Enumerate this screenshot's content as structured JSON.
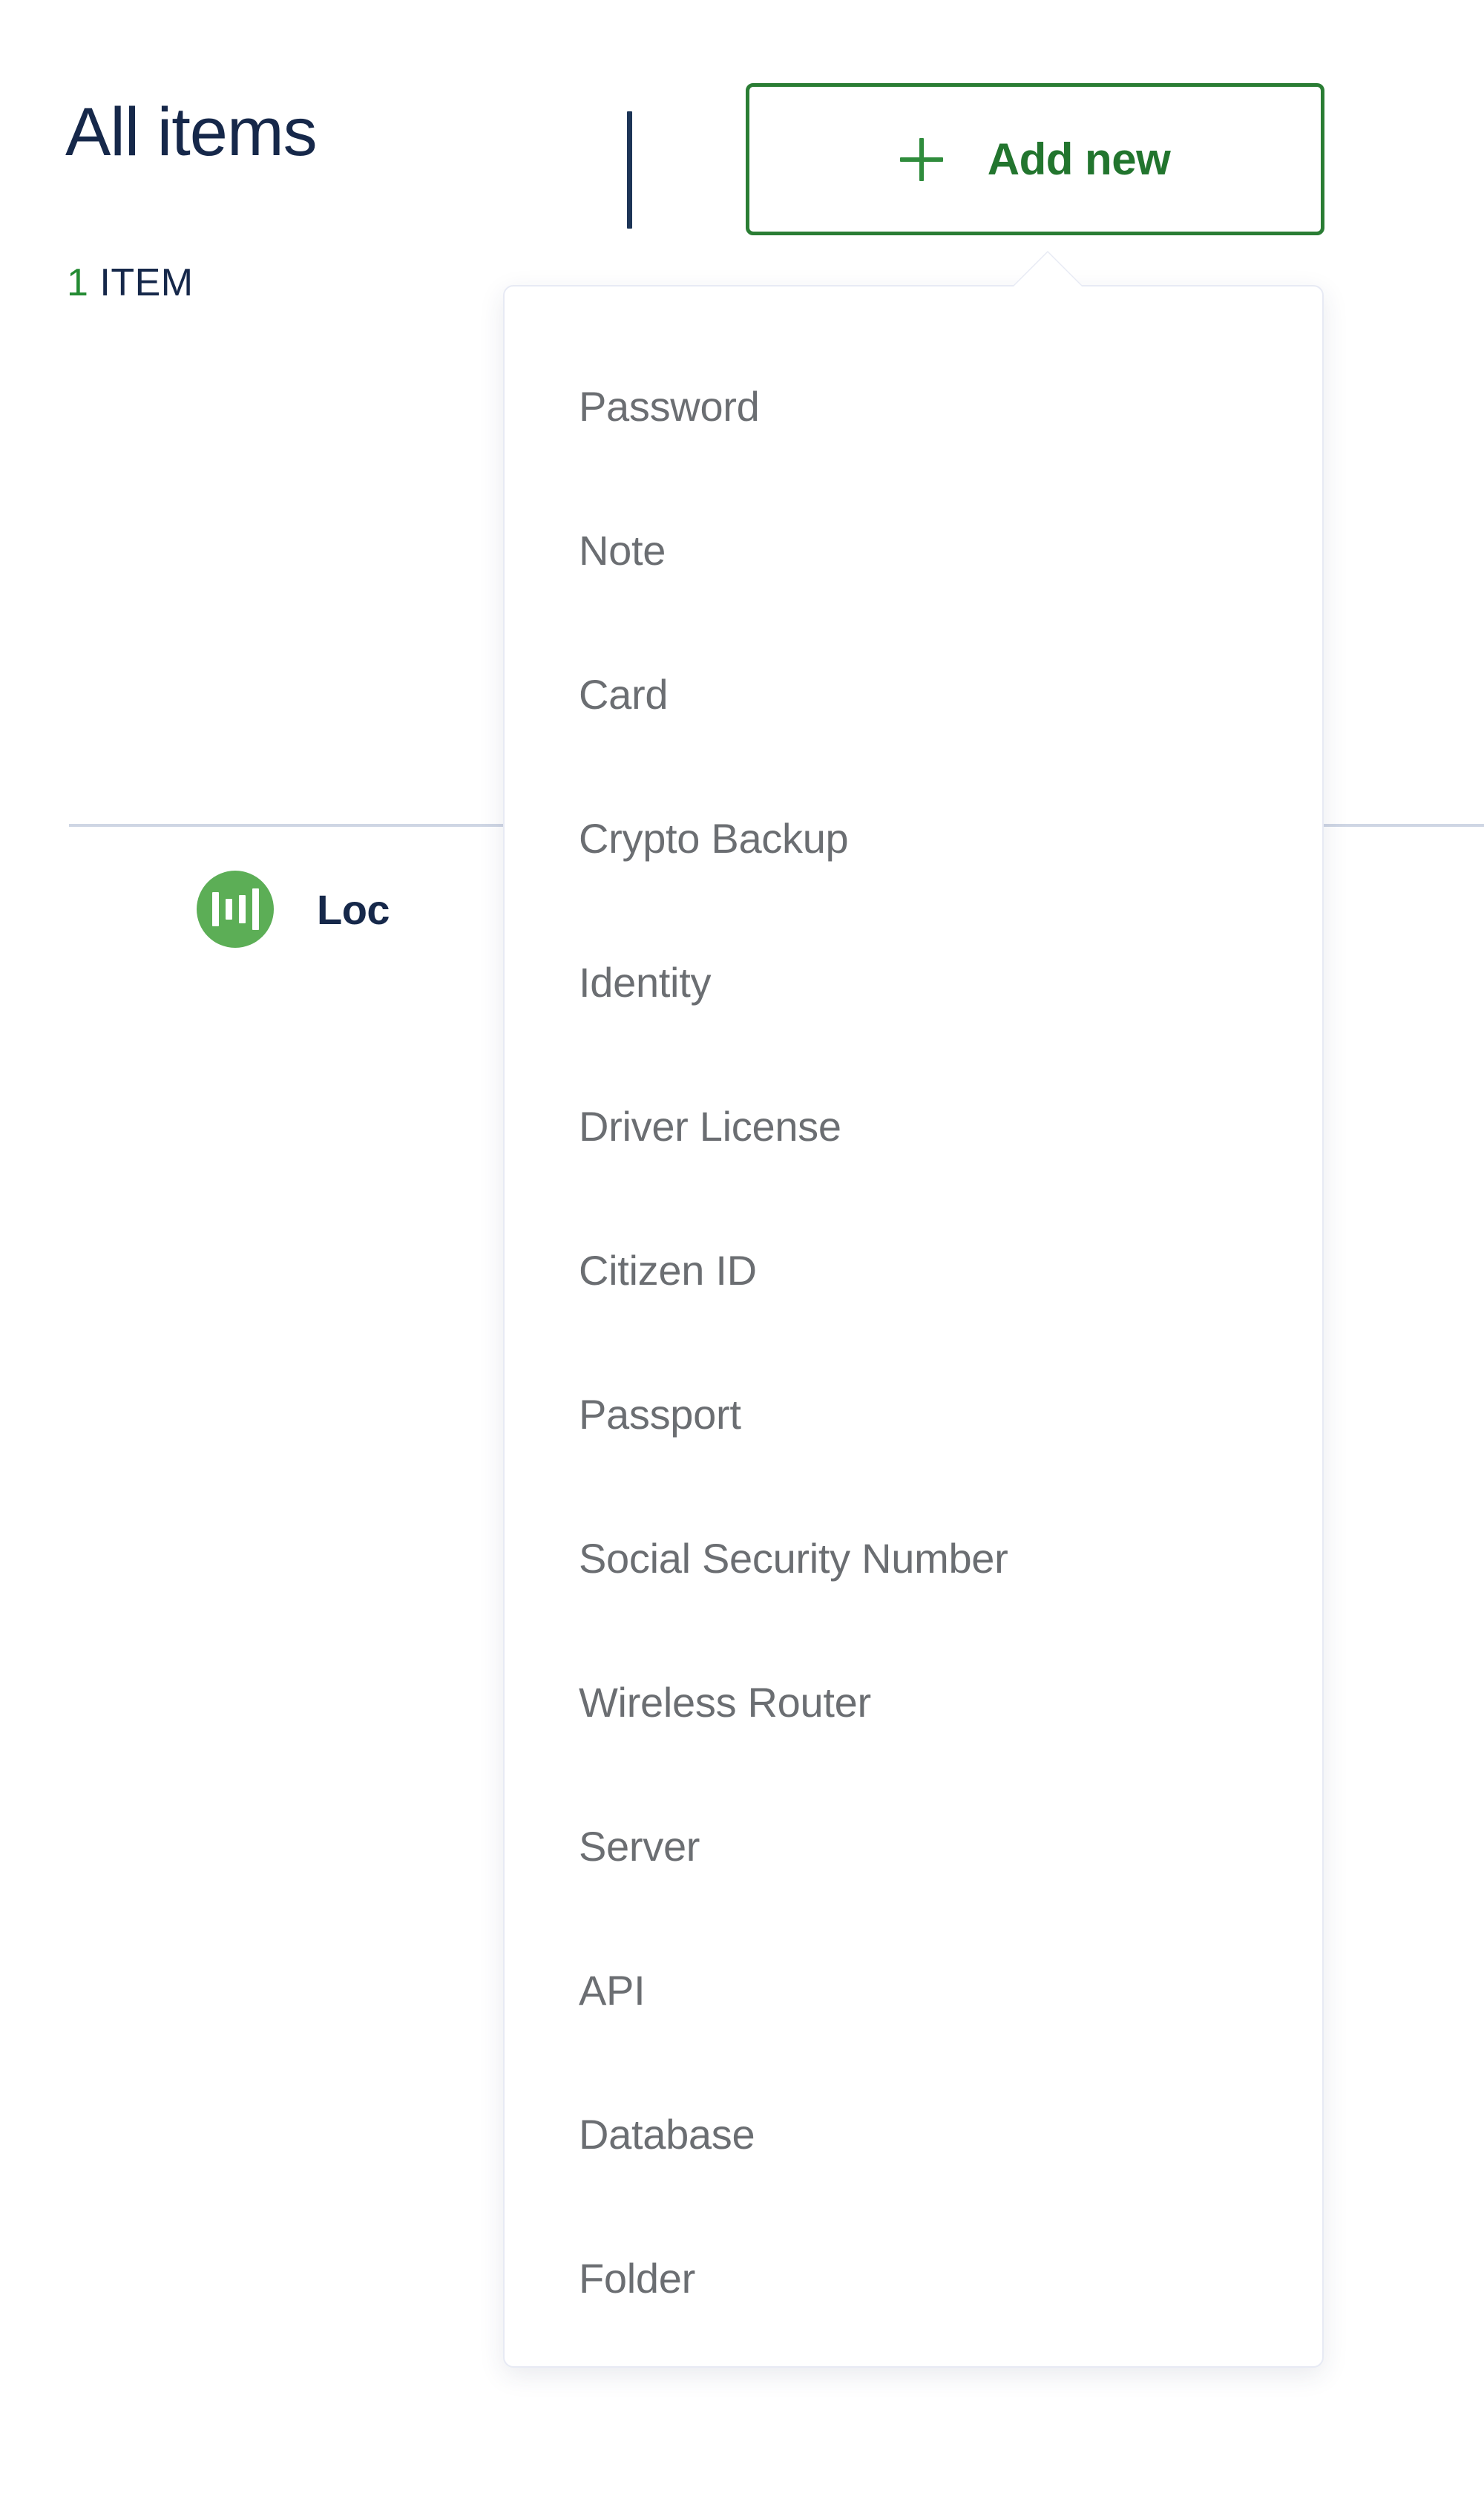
{
  "header": {
    "title": "All items",
    "count_number": "1",
    "count_label": "ITEM",
    "divider_color": "#1d3557"
  },
  "add_new_button": {
    "label": "Add new",
    "plus_icon": "plus-icon",
    "border_color": "#2a7d34",
    "text_color": "#22752e"
  },
  "dropdown": {
    "items": [
      {
        "label": "Password"
      },
      {
        "label": "Note"
      },
      {
        "label": "Card"
      },
      {
        "label": "Crypto Backup"
      },
      {
        "label": "Identity"
      },
      {
        "label": "Driver License"
      },
      {
        "label": "Citizen ID"
      },
      {
        "label": "Passport"
      },
      {
        "label": "Social Security Number"
      },
      {
        "label": "Wireless Router"
      },
      {
        "label": "Server"
      },
      {
        "label": "API"
      },
      {
        "label": "Database"
      },
      {
        "label": "Folder"
      }
    ],
    "border_color": "#e7eaf4",
    "text_color": "#6b6e72"
  },
  "list": {
    "divider_color": "#cfd6e4",
    "rows": [
      {
        "name": "Loc",
        "icon": "vault-bars-icon",
        "icon_color": "#5cae56"
      }
    ]
  }
}
